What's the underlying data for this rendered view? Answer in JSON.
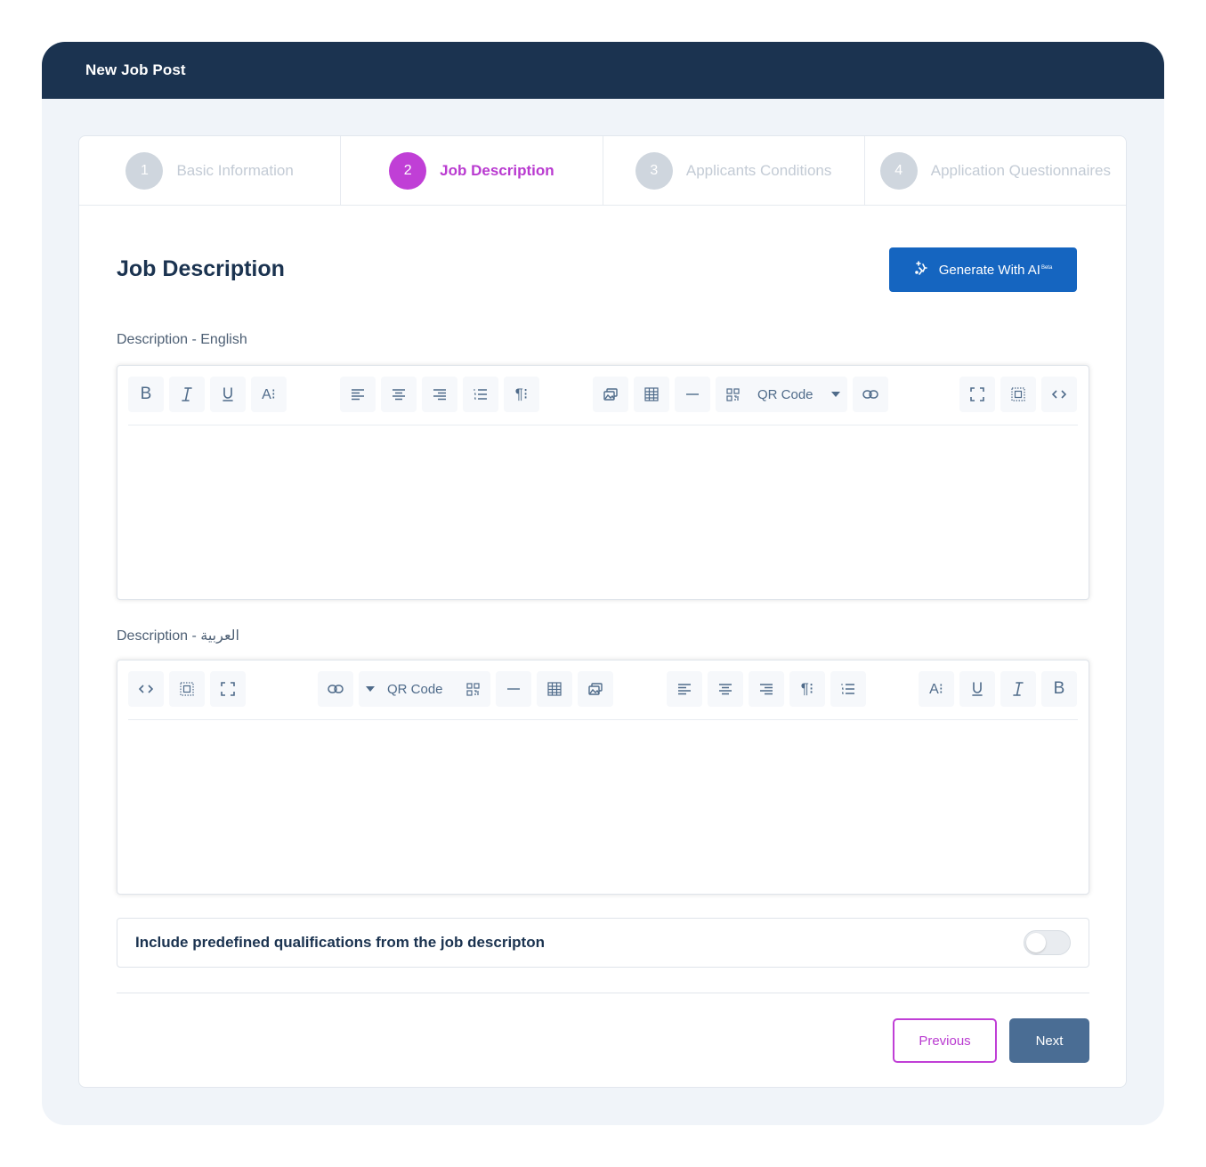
{
  "window": {
    "title": "New Job Post"
  },
  "stepper": {
    "steps": [
      {
        "number": "1",
        "label": "Basic Information",
        "state": "inactive"
      },
      {
        "number": "2",
        "label": "Job Description",
        "state": "active"
      },
      {
        "number": "3",
        "label": "Applicants Conditions",
        "state": "inactive"
      },
      {
        "number": "4",
        "label": "Application Questionnaires",
        "state": "inactive"
      }
    ]
  },
  "section": {
    "title": "Job Description",
    "ai_button": {
      "label": "Generate With AI",
      "badge": "Beta"
    }
  },
  "editors": {
    "english": {
      "label": "Description - English",
      "qr_label": "QR Code",
      "bold": "B",
      "font_size": "A⁝",
      "content": ""
    },
    "arabic": {
      "label": "Description - العربية",
      "qr_label": "QR Code",
      "bold": "B",
      "font_size": "A⁝",
      "content": ""
    }
  },
  "qualifications": {
    "label": "Include predefined qualifications from the job descripton",
    "enabled": false
  },
  "footer": {
    "previous_label": "Previous",
    "next_label": "Next"
  },
  "colors": {
    "header_bg": "#1b3350",
    "accent": "#c03fd6",
    "primary_button": "#1565c0",
    "next_button": "#4a6d94"
  }
}
